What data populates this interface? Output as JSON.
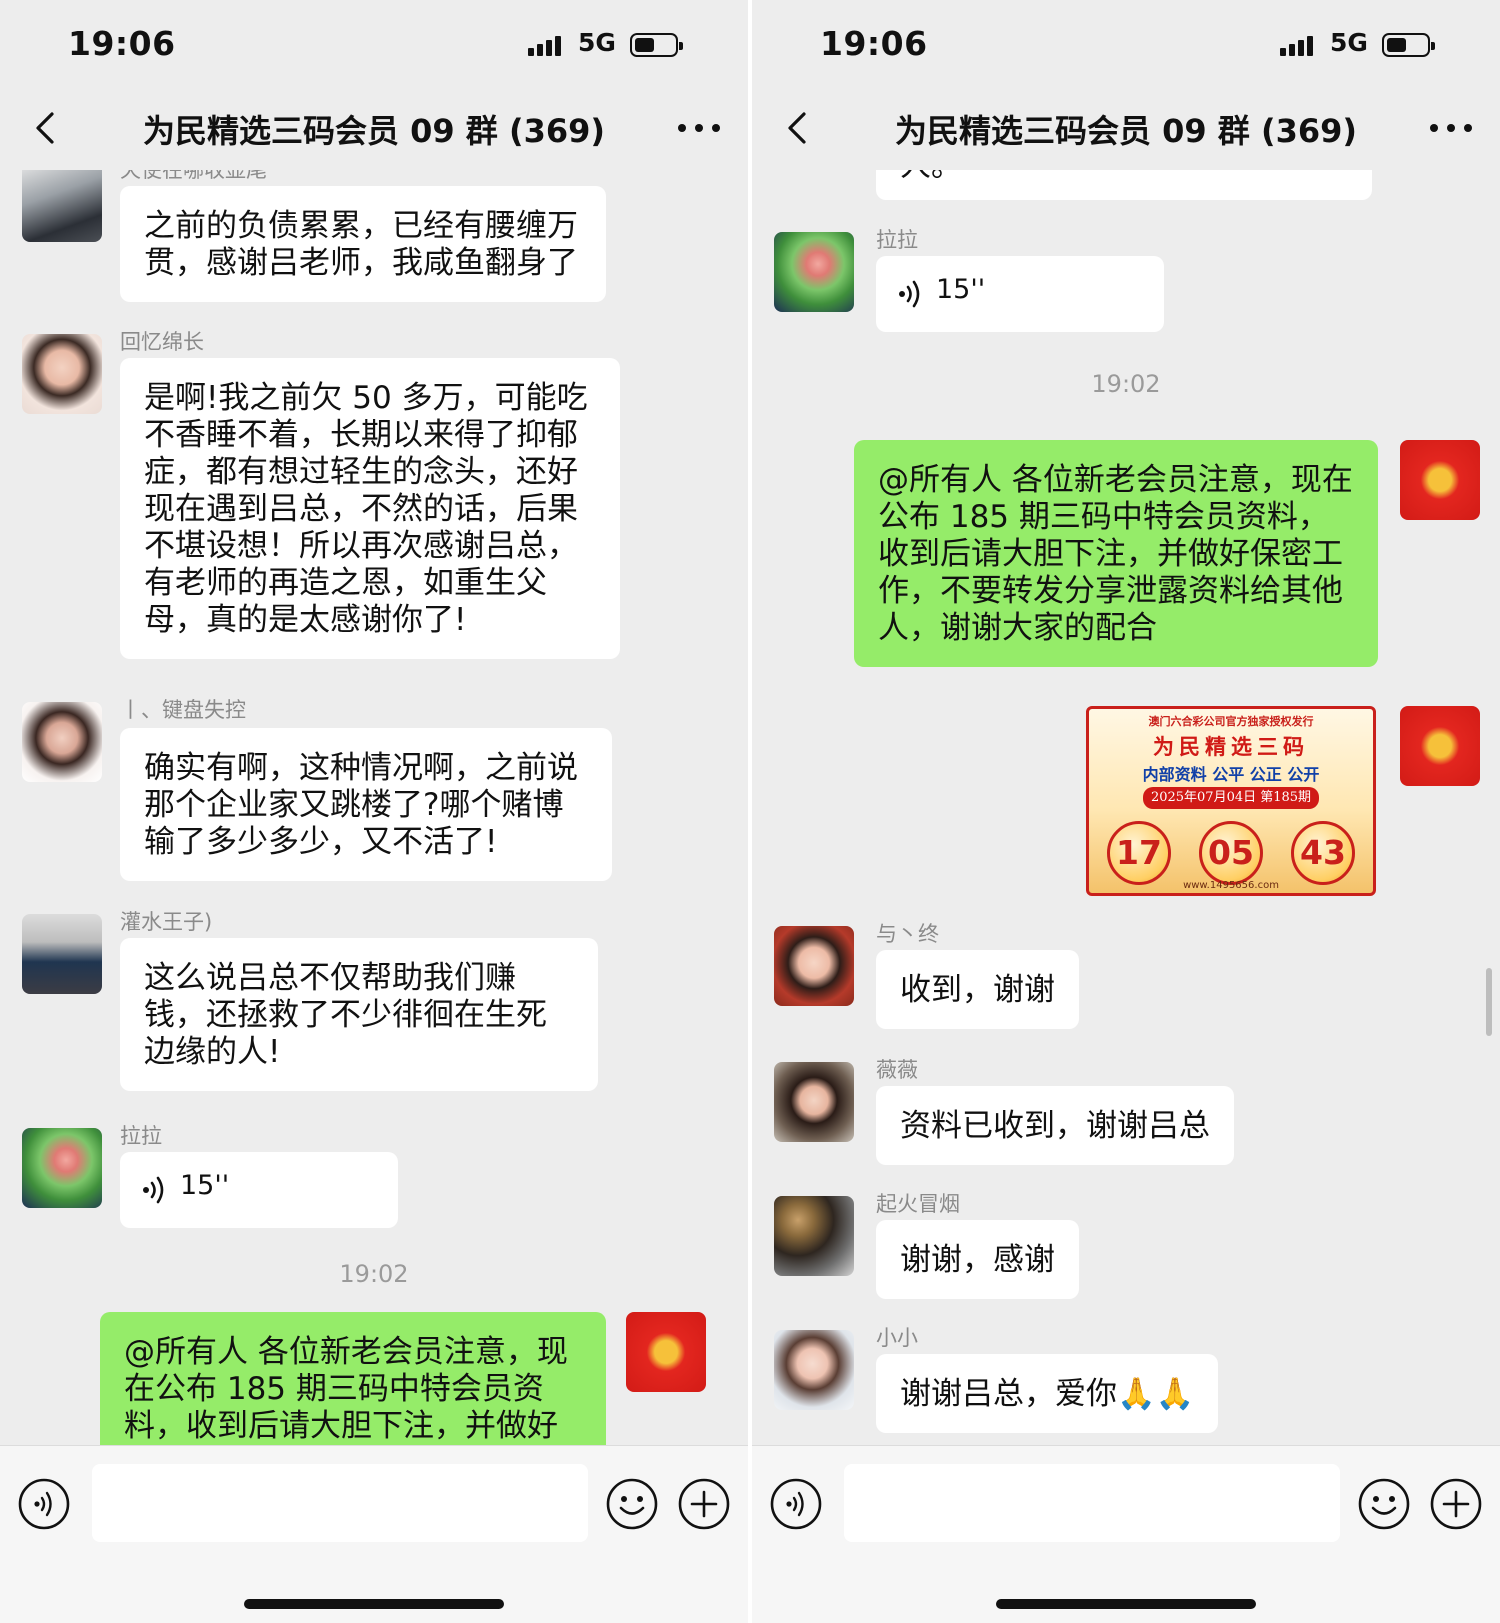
{
  "status": {
    "time": "19:06",
    "network": "5G"
  },
  "header": {
    "title": "为民精选三码会员 09 群 (369)"
  },
  "left": {
    "top_cut_name": "天使在哪收显尾",
    "messages": [
      {
        "text": "之前的负债累累，已经有腰缠万贯，感谢吕老师，我咸鱼翻身了"
      },
      {
        "name": "回忆绵长",
        "text": "是啊!我之前欠 50 多万，可能吃不香睡不着，长期以来得了抑郁症，都有想过轻生的念头，还好现在遇到吕总，不然的话，后果不堪设想！所以再次感谢吕总，有老师的再造之恩，如重生父母，真的是太感谢你了!"
      },
      {
        "name": "丨、键盘失控",
        "text": "确实有啊，这种情况啊，之前说那个企业家又跳楼了?哪个赌博输了多少多少，又不活了!"
      },
      {
        "name": "灌水王子)",
        "text": "这么说吕总不仅帮助我们赚钱，还拯救了不少徘徊在生死边缘的人!"
      },
      {
        "name": "拉拉",
        "voice": "15''"
      }
    ],
    "timestamp": "19:02",
    "own_message": "@所有人  各位新老会员注意，现在公布 185 期三码中特会员资料，收到后请大胆下注，并做好保密"
  },
  "right": {
    "top_cut_text": "人。",
    "voice": {
      "name": "拉拉",
      "duration": "15''"
    },
    "timestamp": "19:02",
    "own_message": "@所有人  各位新老会员注意，现在公布 185 期三码中特会员资料，收到后请大胆下注，并做好保密工作，不要转发分享泄露资料给其他人，谢谢大家的配合",
    "promo": {
      "top_line": "澳门六合彩公司官方独家授权发行",
      "title": "为民精选三码",
      "subtitle": "内部资料  公平 公正 公开",
      "date": "2025年07月04日 第185期",
      "numbers": [
        "17",
        "05",
        "43"
      ],
      "footer": "www.1495656.com"
    },
    "messages": [
      {
        "name": "与丶终",
        "text": "收到，谢谢"
      },
      {
        "name": "薇薇",
        "text": "资料已收到，谢谢吕总"
      },
      {
        "name": "起火冒烟",
        "text": "谢谢，感谢"
      },
      {
        "name": "小小",
        "text": "谢谢吕总，爱你🙏🙏"
      }
    ]
  },
  "icons": [
    "back-chevron-icon",
    "more-dots-icon",
    "signal-icon",
    "battery-icon",
    "voice-wave-icon",
    "emoji-icon",
    "plus-icon"
  ],
  "colors": {
    "background": "#ededed",
    "incoming_bubble": "#ffffff",
    "outgoing_bubble": "#95ec69",
    "name_text": "#8a8a8a",
    "promo_red": "#d01a16"
  }
}
